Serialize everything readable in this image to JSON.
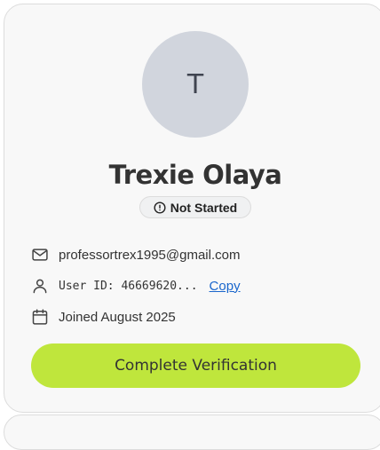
{
  "profile": {
    "avatar_initial": "T",
    "name": "Trexie Olaya",
    "status": "Not Started",
    "email": "professortrex1995@gmail.com",
    "user_id_text": "User ID: 46669620...",
    "copy_label": "Copy",
    "joined": "Joined August 2025"
  },
  "actions": {
    "complete_label": "Complete Verification"
  },
  "icons": {
    "status": "alert-circle-icon",
    "email": "mail-icon",
    "user": "user-icon",
    "joined": "calendar-icon"
  },
  "colors": {
    "accent": "#bfe63c",
    "avatar_bg": "#d1d5dd",
    "link": "#1a66cc",
    "card_bg": "#f8f8f8"
  }
}
